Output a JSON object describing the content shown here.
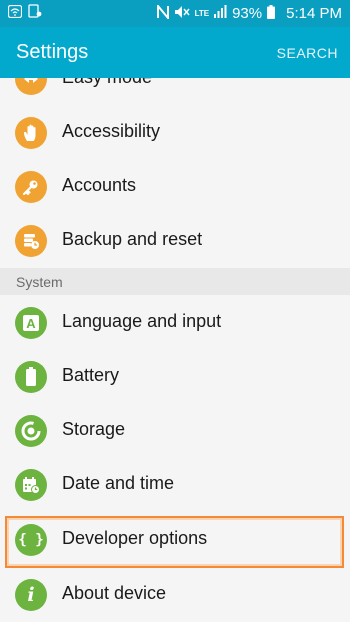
{
  "status_bar": {
    "lte": "LTE",
    "battery": "93%",
    "time": "5:14 PM"
  },
  "header": {
    "title": "Settings",
    "search_label": "SEARCH"
  },
  "items": [
    {
      "label": "Easy mode",
      "icon": "easy-mode-icon",
      "color": "#f0a232"
    },
    {
      "label": "Accessibility",
      "icon": "hand-icon",
      "color": "#f0a232"
    },
    {
      "label": "Accounts",
      "icon": "key-icon",
      "color": "#f0a232"
    },
    {
      "label": "Backup and reset",
      "icon": "backup-icon",
      "color": "#f0a232"
    }
  ],
  "section": {
    "label": "System"
  },
  "system_items": [
    {
      "label": "Language and input",
      "icon": "language-icon",
      "color": "#6cb33f"
    },
    {
      "label": "Battery",
      "icon": "battery-icon",
      "color": "#6cb33f"
    },
    {
      "label": "Storage",
      "icon": "storage-icon",
      "color": "#6cb33f"
    },
    {
      "label": "Date and time",
      "icon": "calendar-icon",
      "color": "#6cb33f"
    },
    {
      "label": "Developer options",
      "icon": "braces-icon",
      "color": "#6cb33f"
    },
    {
      "label": "About device",
      "icon": "info-icon",
      "color": "#6cb33f"
    }
  ],
  "icon_glyphs": {
    "language": "A",
    "braces": "{ }",
    "info": "i"
  },
  "highlight_color": "#f28a3a"
}
